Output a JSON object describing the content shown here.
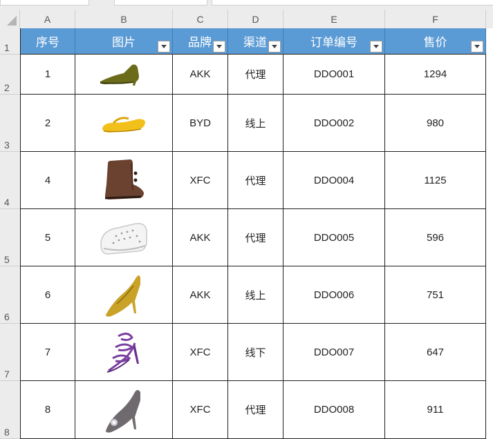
{
  "columns": [
    "A",
    "B",
    "C",
    "D",
    "E",
    "F"
  ],
  "row_numbers": [
    "1",
    "2",
    "3",
    "4",
    "5",
    "6",
    "7",
    "8"
  ],
  "headers": {
    "seq": "序号",
    "image": "图片",
    "brand": "品牌",
    "channel": "渠道",
    "order": "订单编号",
    "price": "售价"
  },
  "rows": [
    {
      "seq": "1",
      "image_icon": "olive-kitten-heel-bootie-icon",
      "brand": "AKK",
      "channel": "代理",
      "order": "DDO001",
      "price": "1294"
    },
    {
      "seq": "2",
      "image_icon": "yellow-flat-sandal-icon",
      "brand": "BYD",
      "channel": "线上",
      "order": "DDO002",
      "price": "980"
    },
    {
      "seq": "4",
      "image_icon": "brown-fur-boot-icon",
      "brand": "XFC",
      "channel": "代理",
      "order": "DDO004",
      "price": "1125"
    },
    {
      "seq": "5",
      "image_icon": "white-studded-slip-on-icon",
      "brand": "AKK",
      "channel": "代理",
      "order": "DDO005",
      "price": "596"
    },
    {
      "seq": "6",
      "image_icon": "gold-stiletto-pump-icon",
      "brand": "AKK",
      "channel": "线上",
      "order": "DDO006",
      "price": "751"
    },
    {
      "seq": "7",
      "image_icon": "purple-strappy-heel-sandal-icon",
      "brand": "XFC",
      "channel": "线下",
      "order": "DDO007",
      "price": "647"
    },
    {
      "seq": "8",
      "image_icon": "grey-jeweled-pump-icon",
      "brand": "XFC",
      "channel": "代理",
      "order": "DDO008",
      "price": "911"
    }
  ],
  "colors": {
    "header_fill": "#5b9bd5",
    "grid_line": "#1f1f1f",
    "sheet_header_bg": "#ececec"
  }
}
